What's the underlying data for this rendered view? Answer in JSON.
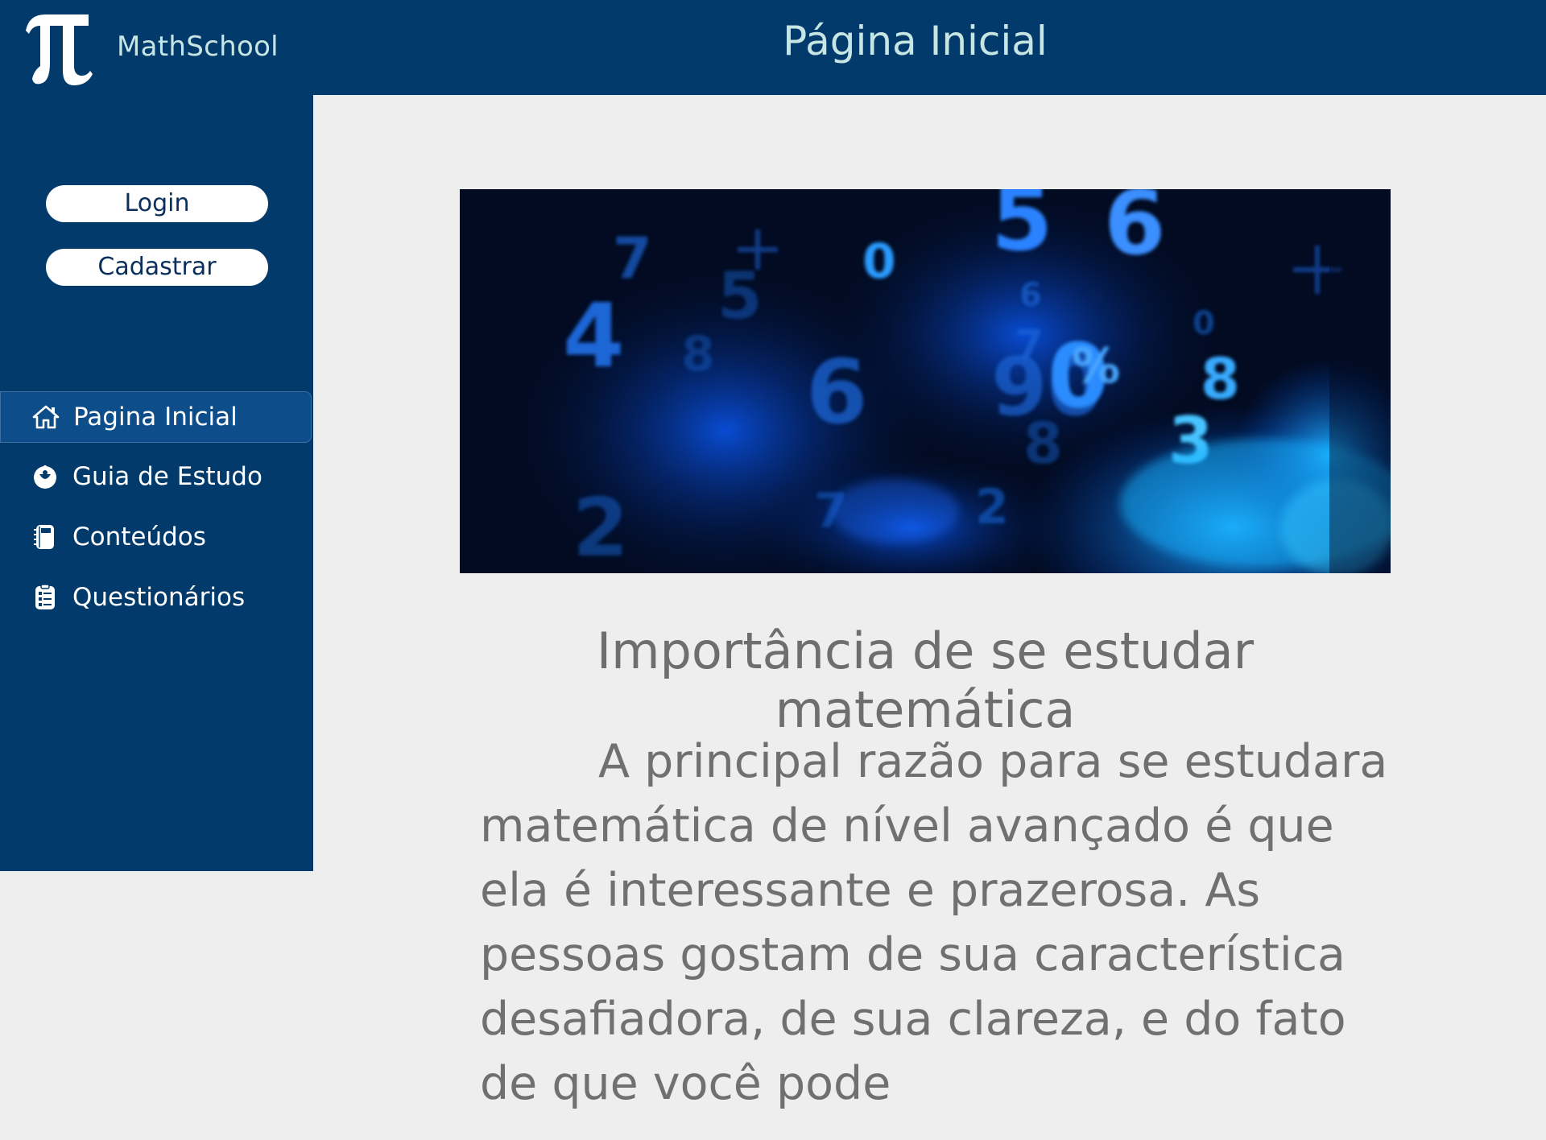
{
  "header": {
    "app_name": "MathSchool",
    "page_title": "Página Inicial",
    "logo_icon": "pi-icon"
  },
  "auth": {
    "login_label": "Login",
    "signup_label": "Cadastrar"
  },
  "sidebar": {
    "items": [
      {
        "label": "Pagina Inicial",
        "icon": "home-icon",
        "active": true
      },
      {
        "label": "Guia de Estudo",
        "icon": "compass-icon",
        "active": false
      },
      {
        "label": "Conteúdos",
        "icon": "notebook-icon",
        "active": false
      },
      {
        "label": "Questionários",
        "icon": "checklist-icon",
        "active": false
      }
    ]
  },
  "main": {
    "hero_image": "blue-numbers-banner",
    "heading": "Importância de se estudar matemática",
    "body": "A principal razão para se estudara matemática de nível avançado é que ela é interessante e prazerosa. As pessoas gostam de sua característica desafiadora, de sua clareza, e do fato de que você pode"
  },
  "colors": {
    "navy": "#013a6b",
    "active_item": "#0d4d8a",
    "header_text": "#c7e6e3",
    "page_bg": "#eeeeee",
    "body_text": "#707070"
  }
}
